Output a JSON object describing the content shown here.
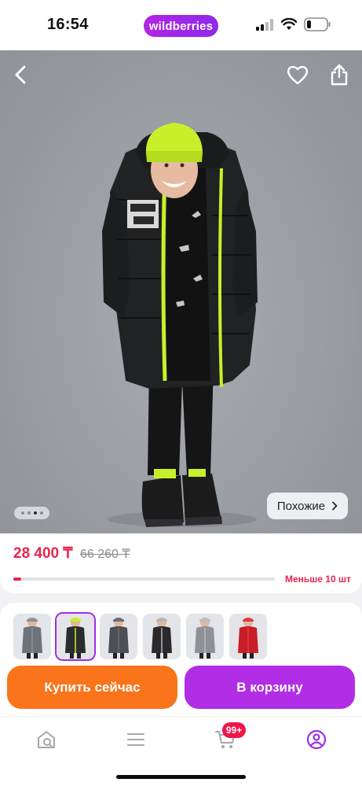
{
  "status_bar": {
    "time": "16:54",
    "brand_pill": "wildberries"
  },
  "product": {
    "price": "28 400 ₸",
    "old_price": "66 260 ₸",
    "stock_label": "Меньше 10 шт",
    "stock_level": 0.03,
    "similar_label": "Похожие",
    "gallery_dots_total": 4,
    "gallery_dot_active": 3
  },
  "color_variants": [
    {
      "name": "grey-green",
      "jacket": "#6d7479",
      "accent": "#8b9298",
      "selected": false
    },
    {
      "name": "black-lime",
      "jacket": "#2b2c2e",
      "accent": "#c8f02a",
      "selected": true
    },
    {
      "name": "dark-grey",
      "jacket": "#4c4f53",
      "accent": "#6a6e73",
      "selected": false
    },
    {
      "name": "black-grey",
      "jacket": "#2a2a2c",
      "accent": "#b4b6ba",
      "selected": false
    },
    {
      "name": "light-grey",
      "jacket": "#8e9196",
      "accent": "#b9bcc0",
      "selected": false
    },
    {
      "name": "red",
      "jacket": "#c91d27",
      "accent": "#e13a3f",
      "selected": false
    }
  ],
  "actions": {
    "buy_now": "Купить сейчас",
    "add_to_cart": "В корзину"
  },
  "bottom_nav": {
    "cart_badge": "99+",
    "accent_color": "#9b2fe8"
  },
  "colors": {
    "price_red": "#e8244f",
    "buy_orange": "#f9741a",
    "cart_purple": "#b22de6",
    "lime": "#c8f02a"
  }
}
